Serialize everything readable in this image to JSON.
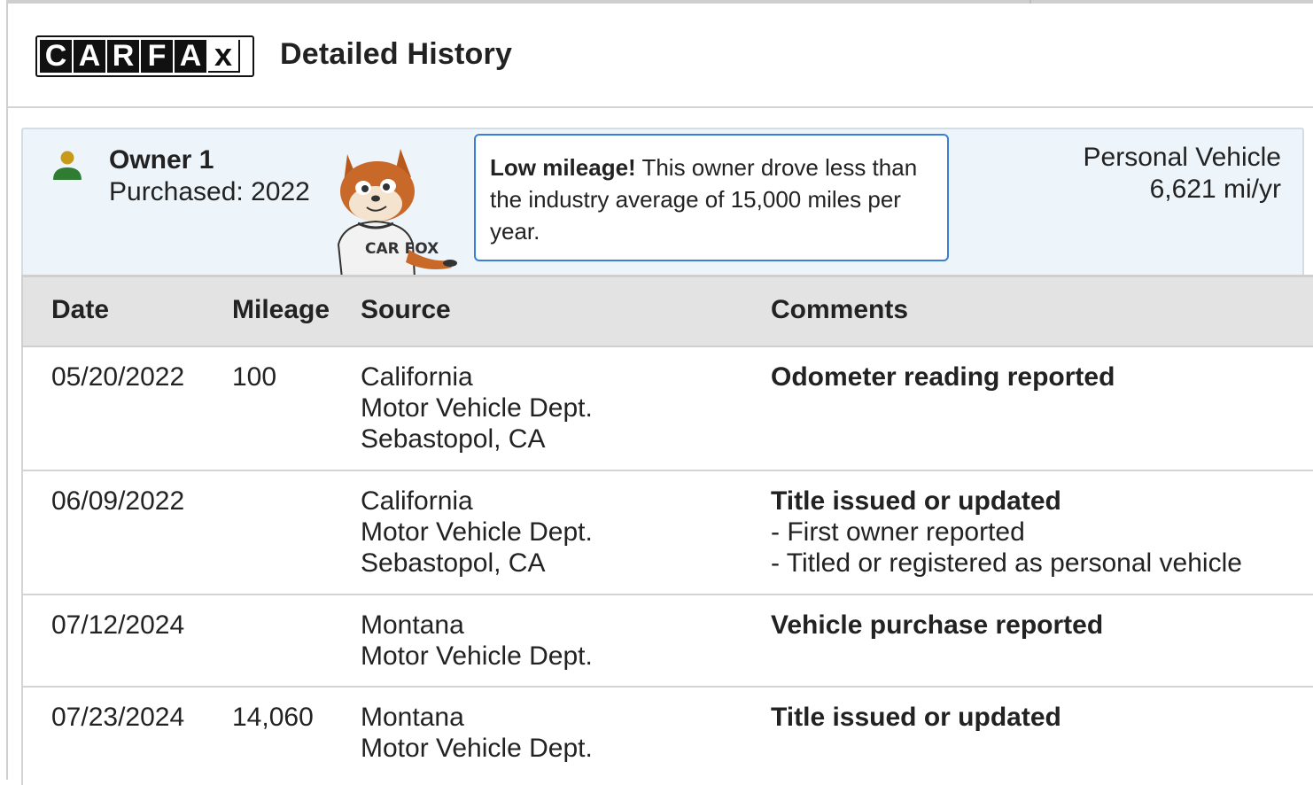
{
  "header": {
    "logo_letters": [
      "C",
      "A",
      "R",
      "F",
      "A",
      "X"
    ],
    "title": "Detailed History"
  },
  "owner": {
    "title": "Owner 1",
    "purchased": "Purchased: 2022",
    "mascot_shirt_text": "CAR FOX",
    "callout_bold": "Low mileage!",
    "callout_text": " This owner drove less than the industry average of 15,000 miles per year.",
    "vehicle_type": "Personal Vehicle",
    "mileage_per_year": "6,621 mi/yr",
    "icon_colors": {
      "head": "#c89a1a",
      "body": "#2e7d32"
    }
  },
  "table": {
    "columns": [
      "Date",
      "Mileage",
      "Source",
      "Comments"
    ],
    "rows": [
      {
        "date": "05/20/2022",
        "mileage": "100",
        "source": [
          "California",
          "Motor Vehicle Dept.",
          "Sebastopol, CA"
        ],
        "comment_title": "Odometer reading reported",
        "comment_items": []
      },
      {
        "date": "06/09/2022",
        "mileage": "",
        "source": [
          "California",
          "Motor Vehicle Dept.",
          "Sebastopol, CA"
        ],
        "comment_title": "Title issued or updated",
        "comment_items": [
          "- First owner reported",
          "- Titled or registered as personal vehicle"
        ]
      },
      {
        "date": "07/12/2024",
        "mileage": "",
        "source": [
          "Montana",
          "Motor Vehicle Dept."
        ],
        "comment_title": "Vehicle purchase reported",
        "comment_items": []
      },
      {
        "date": "07/23/2024",
        "mileage": "14,060",
        "source": [
          "Montana",
          "Motor Vehicle Dept."
        ],
        "comment_title": "Title issued or updated",
        "comment_items": []
      }
    ]
  }
}
